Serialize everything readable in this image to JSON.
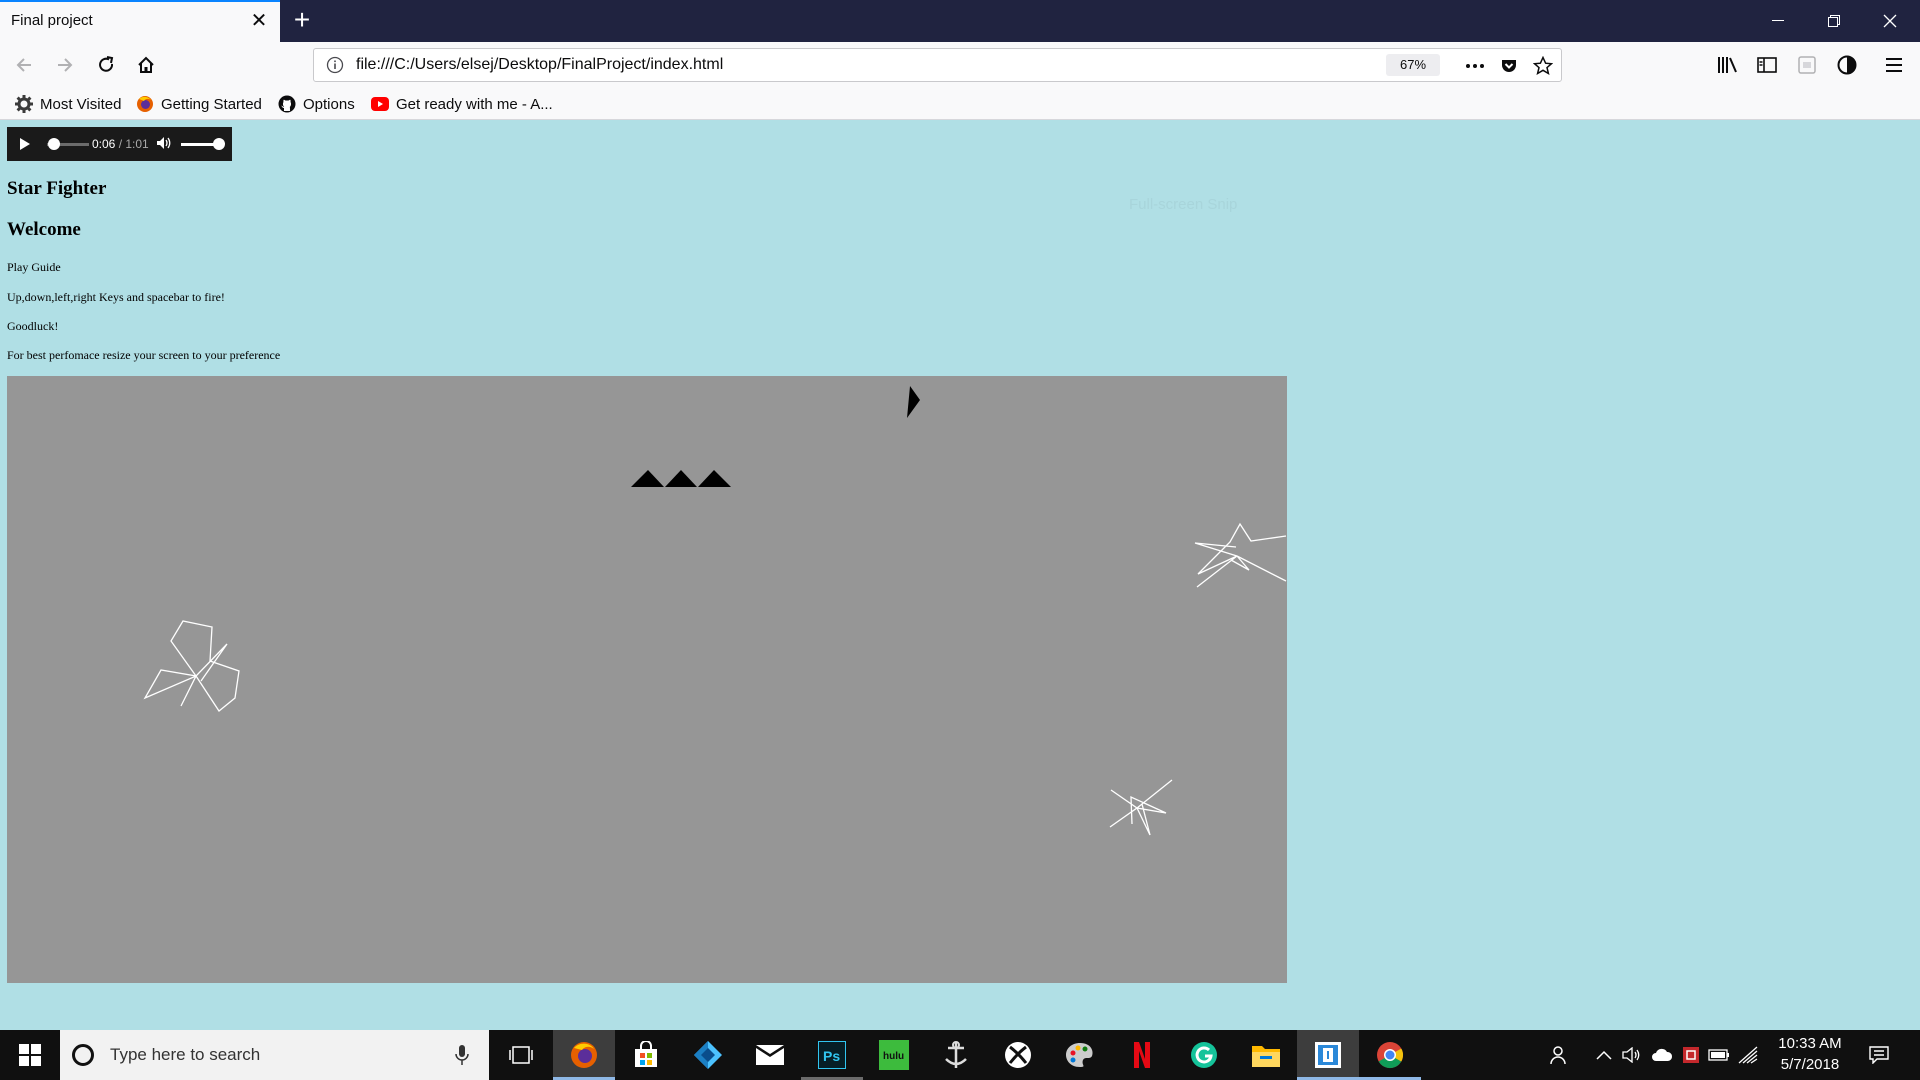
{
  "browser": {
    "tab_title": "Final project",
    "url": "file:///C:/Users/elsej/Desktop/FinalProject/index.html",
    "zoom": "67%",
    "bookmarks": [
      {
        "label": "Most Visited",
        "icon": "gear-icon"
      },
      {
        "label": "Getting Started",
        "icon": "firefox-icon"
      },
      {
        "label": "Options",
        "icon": "github-icon"
      },
      {
        "label": "Get ready with me - A...",
        "icon": "youtube-icon"
      }
    ]
  },
  "page": {
    "audio": {
      "current": "0:06",
      "duration": "/ 1:01",
      "progress": 0.1,
      "volume": 1.0
    },
    "title": "Star Fighter",
    "welcome": "Welcome",
    "play_guide": "Play Guide",
    "controls_text": "Up,down,left,right Keys and spacebar to fire!",
    "goodluck": "Goodluck!",
    "tip": "For best perfomace resize your screen to your preference",
    "fullscreen_label": "Full-screen Snip"
  },
  "game": {
    "lives": 3,
    "asteroids": 3,
    "colors": {
      "canvas": "#969696",
      "page": "#b0dfe5",
      "ship": "#000000",
      "asteroid": "#ffffff"
    }
  },
  "taskbar": {
    "search_placeholder": "Type here to search",
    "apps": [
      "task-view-icon",
      "firefox-icon",
      "store-icon",
      "vs-code-icon",
      "mail-icon",
      "photoshop-icon",
      "hulu-icon",
      "world-of-warships-icon",
      "xbox-icon",
      "paint-icon",
      "netflix-icon",
      "grammarly-icon",
      "file-explorer-icon",
      "snip-icon",
      "chrome-icon"
    ],
    "time": "10:33 AM",
    "date": "5/7/2018"
  }
}
